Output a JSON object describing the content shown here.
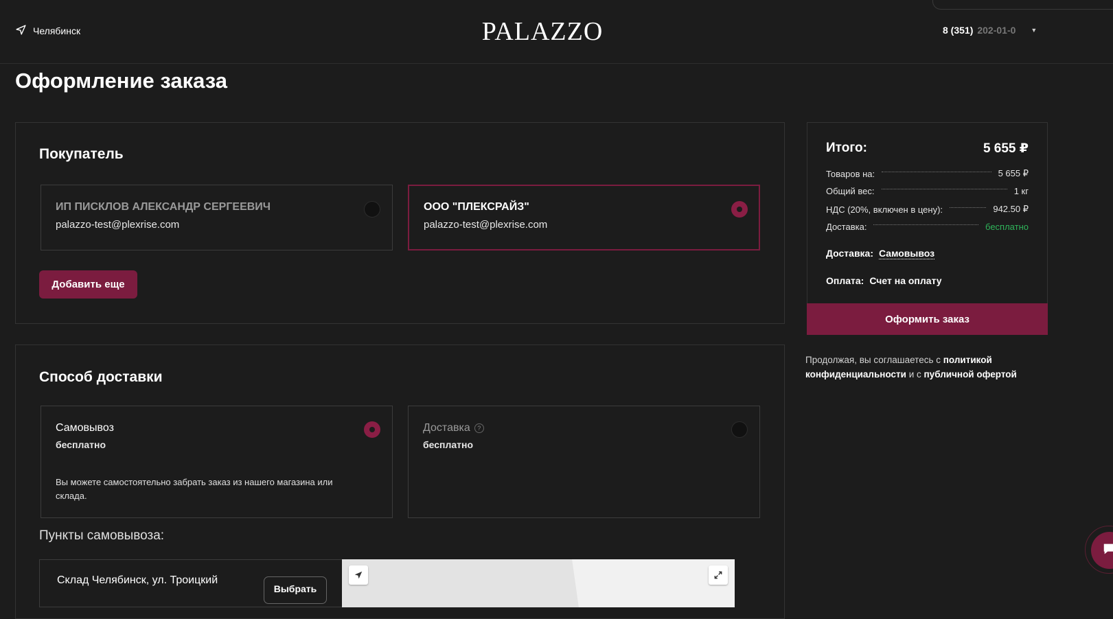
{
  "header": {
    "city": "Челябинск",
    "logo": "PALAZZO",
    "phone_main": "8 (351)",
    "phone_rest": "202-01-0"
  },
  "page": {
    "title": "Оформление заказа"
  },
  "buyer": {
    "title": "Покупатель",
    "options": [
      {
        "name": "ИП ПИСКЛОВ АЛЕКСАНДР СЕРГЕЕВИЧ",
        "email": "palazzo-test@plexrise.com",
        "selected": false
      },
      {
        "name": "ООО \"ПЛЕКСРАЙЗ\"",
        "email": "palazzo-test@plexrise.com",
        "selected": true
      }
    ],
    "add_label": "Добавить еще"
  },
  "delivery": {
    "title": "Способ доставки",
    "options": [
      {
        "name": "Самовывоз",
        "price": "бесплатно",
        "description": "Вы можете самостоятельно забрать заказ из нашего магазина или склада.",
        "selected": true
      },
      {
        "name": "Доставка",
        "price": "бесплатно",
        "help": "?",
        "selected": false
      }
    ],
    "pickup_title": "Пункты самовывоза:",
    "pickup_point": "Склад Челябинск, ул. Троицкий",
    "choose_label": "Выбрать"
  },
  "summary": {
    "total_label": "Итого:",
    "total_value": "5 655 ₽",
    "rows": [
      {
        "label": "Товаров на:",
        "value": "5 655 ₽"
      },
      {
        "label": "Общий вес:",
        "value": "1 кг"
      },
      {
        "label": "НДС (20%, включен в цену):",
        "value": "942.50 ₽"
      },
      {
        "label": "Доставка:",
        "value": "бесплатно"
      }
    ],
    "delivery_label": "Доставка:",
    "delivery_value": "Самовывоз",
    "payment_label": "Оплата:",
    "payment_value": "Счет на оплату",
    "order_label": "Оформить заказ",
    "agree_text_1": "Продолжая, вы соглашаетесь с",
    "agree_link_1": "политикой конфиденциальности",
    "agree_text_2": "и с",
    "agree_link_2": "публичной офертой"
  },
  "colors": {
    "accent": "#7b1c3f",
    "background": "#1c1c1c",
    "success": "#2fb35a"
  }
}
